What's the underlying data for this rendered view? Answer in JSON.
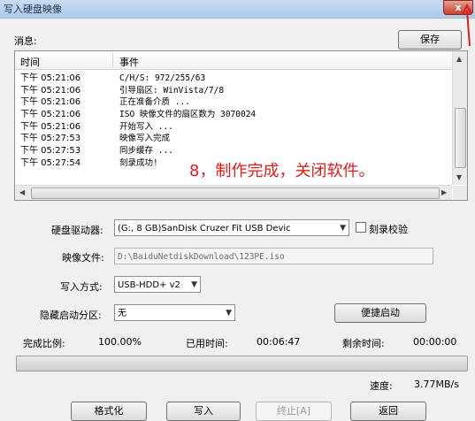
{
  "window": {
    "title": "写入硬盘映像",
    "close_glyph": "x"
  },
  "log": {
    "label": "消息:",
    "save_label": "保存",
    "columns": [
      "时间",
      "事件"
    ],
    "rows": [
      {
        "time": "下午 05:21:06",
        "event": "C/H/S: 972/255/63"
      },
      {
        "time": "下午 05:21:06",
        "event": "引导扇区: WinVista/7/8"
      },
      {
        "time": "下午 05:21:06",
        "event": "正在准备介质 ..."
      },
      {
        "time": "下午 05:21:06",
        "event": "ISO 映像文件的扇区数为 3070024"
      },
      {
        "time": "下午 05:21:06",
        "event": "开始写入 ..."
      },
      {
        "time": "下午 05:27:53",
        "event": "映像写入完成"
      },
      {
        "time": "下午 05:27:53",
        "event": "同步缓存 ..."
      },
      {
        "time": "下午 05:27:54",
        "event": "刻录成功!"
      }
    ]
  },
  "annotation": {
    "text": "8，制作完成，关闭软件。",
    "color": "#e01b1b"
  },
  "form": {
    "drive_label": "硬盘驱动器:",
    "drive_value": "(G:, 8 GB)SanDisk Cruzer Fit USB Devic",
    "verify_label": "刻录校验",
    "verify_checked": false,
    "image_label": "映像文件:",
    "image_value": "D:\\BaiduNetdiskDownload\\123PE.iso",
    "method_label": "写入方式:",
    "method_value": "USB-HDD+ v2",
    "hidden_label": "隐藏启动分区:",
    "hidden_value": "无",
    "quick_boot_label": "便捷启动"
  },
  "status": {
    "ratio_label": "完成比例:",
    "ratio_value": "100.00%",
    "elapsed_label": "已用时间:",
    "elapsed_value": "00:06:47",
    "remaining_label": "剩余时间:",
    "remaining_value": "00:00:00",
    "progress_fraction": 1.0,
    "speed_label": "速度:",
    "speed_value": "3.77MB/s"
  },
  "buttons": {
    "format": "格式化",
    "write": "写入",
    "abort": "终止[A]",
    "back": "返回"
  }
}
